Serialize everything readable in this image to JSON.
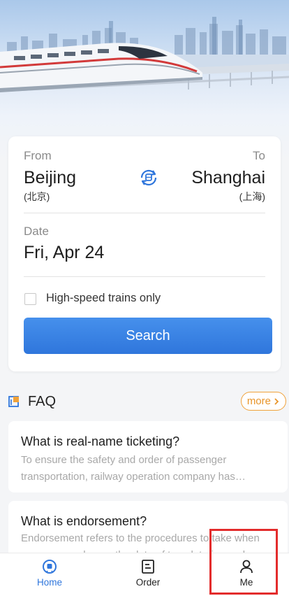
{
  "search": {
    "from_label": "From",
    "to_label": "To",
    "from_city": "Beijing",
    "from_city_cn": "(北京)",
    "to_city": "Shanghai",
    "to_city_cn": "(上海)",
    "date_label": "Date",
    "date_value": "Fri, Apr 24",
    "high_speed_only_label": "High-speed trains only",
    "high_speed_only_checked": false,
    "search_button": "Search",
    "swap_icon": "swap-icon"
  },
  "faq": {
    "title": "FAQ",
    "more_label": "more",
    "items": [
      {
        "question": "What is real-name ticketing?",
        "answer": "To ensure the safety and order of passenger transportation, railway operation company has implemented real-name ticketing for passenger trains."
      },
      {
        "question": "What is endorsement?",
        "answer": "Endorsement refers to the procedures to take when passengers change the date of travel, train number, or seat class."
      }
    ]
  },
  "tabbar": {
    "tabs": [
      {
        "label": "Home",
        "icon": "home-icon",
        "active": true
      },
      {
        "label": "Order",
        "icon": "order-icon",
        "active": false
      },
      {
        "label": "Me",
        "icon": "user-icon",
        "active": false
      }
    ]
  },
  "colors": {
    "primary": "#2f76dc",
    "accent_orange": "#e8952a",
    "highlight_red": "#e32c2c"
  }
}
